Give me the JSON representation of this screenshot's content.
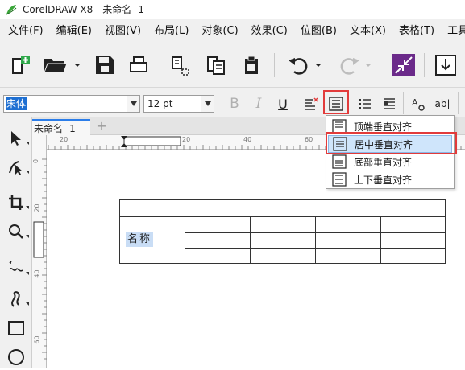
{
  "window": {
    "title": "CorelDRAW X8 - 未命名 -1"
  },
  "menu": [
    "文件(F)",
    "编辑(E)",
    "视图(V)",
    "布局(L)",
    "对象(C)",
    "效果(C)",
    "位图(B)",
    "文本(X)",
    "表格(T)",
    "工具(O)"
  ],
  "property_bar": {
    "font_name": "宋体",
    "font_size": "12 pt",
    "bold_label": "B",
    "italic_label": "I",
    "underline_label": "U",
    "char_format_label": "ab|"
  },
  "document": {
    "tab_label": "未命名 -1",
    "add_tab_label": "+"
  },
  "ruler": {
    "h_labels": [
      "20",
      "20",
      "40",
      "60"
    ],
    "v_labels": [
      "0",
      "20",
      "40",
      "60"
    ]
  },
  "table": {
    "cell_label": "名称"
  },
  "dropdown": {
    "items": [
      {
        "label": "顶端垂直对齐",
        "icon": "align-top-icon"
      },
      {
        "label": "居中垂直对齐",
        "icon": "align-middle-icon"
      },
      {
        "label": "底部垂直对齐",
        "icon": "align-bottom-icon"
      },
      {
        "label": "上下垂直对齐",
        "icon": "align-justify-icon"
      }
    ],
    "highlighted_index": 1
  },
  "colors": {
    "accent": "#2b7de9",
    "highlight_red": "#e23b3b",
    "selection_blue": "#1e6fd2"
  }
}
